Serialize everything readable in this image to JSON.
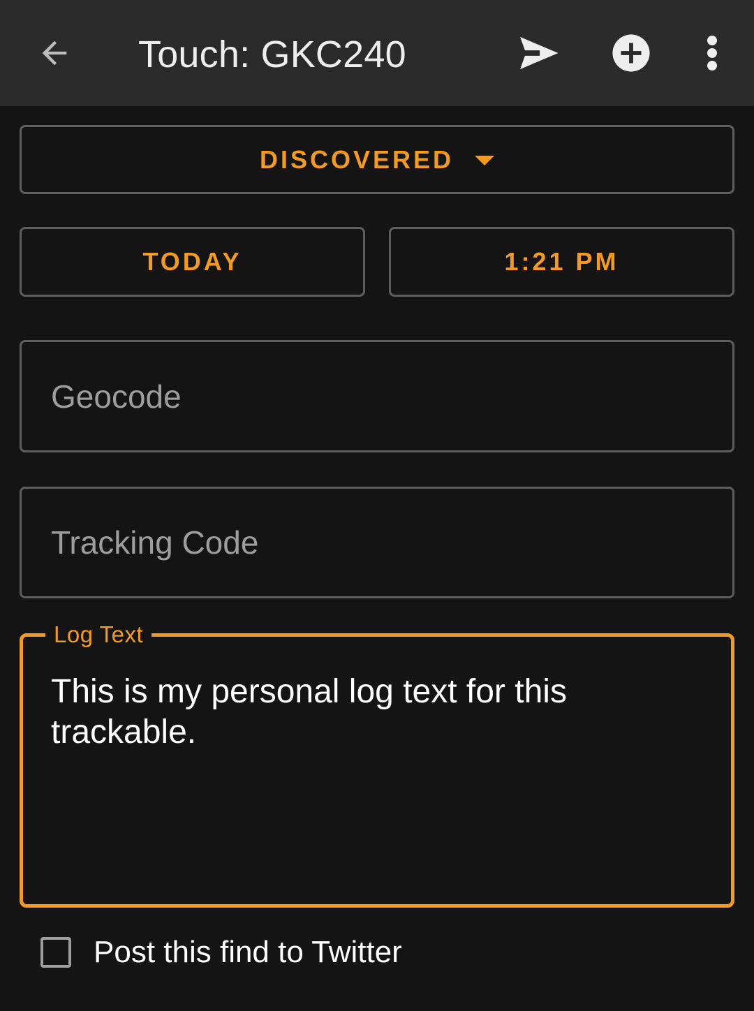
{
  "appbar": {
    "title": "Touch: GKC240",
    "background": "#2a2a2a",
    "icons": [
      "back-arrow-icon",
      "send-icon",
      "add-circle-icon",
      "more-vert-icon"
    ]
  },
  "form": {
    "log_type": "DISCOVERED",
    "date": "TODAY",
    "time": "1:21 PM",
    "geocode_placeholder": "Geocode",
    "tracking_code_placeholder": "Tracking Code",
    "log_text_label": "Log Text",
    "log_text_value": "This is my personal log text for this trackable.",
    "post_to_twitter_label": "Post this find to Twitter",
    "post_to_twitter_checked": false
  },
  "colors": {
    "accent": "#f39a1f",
    "background": "#141414",
    "outline": "#5e5e5e"
  }
}
